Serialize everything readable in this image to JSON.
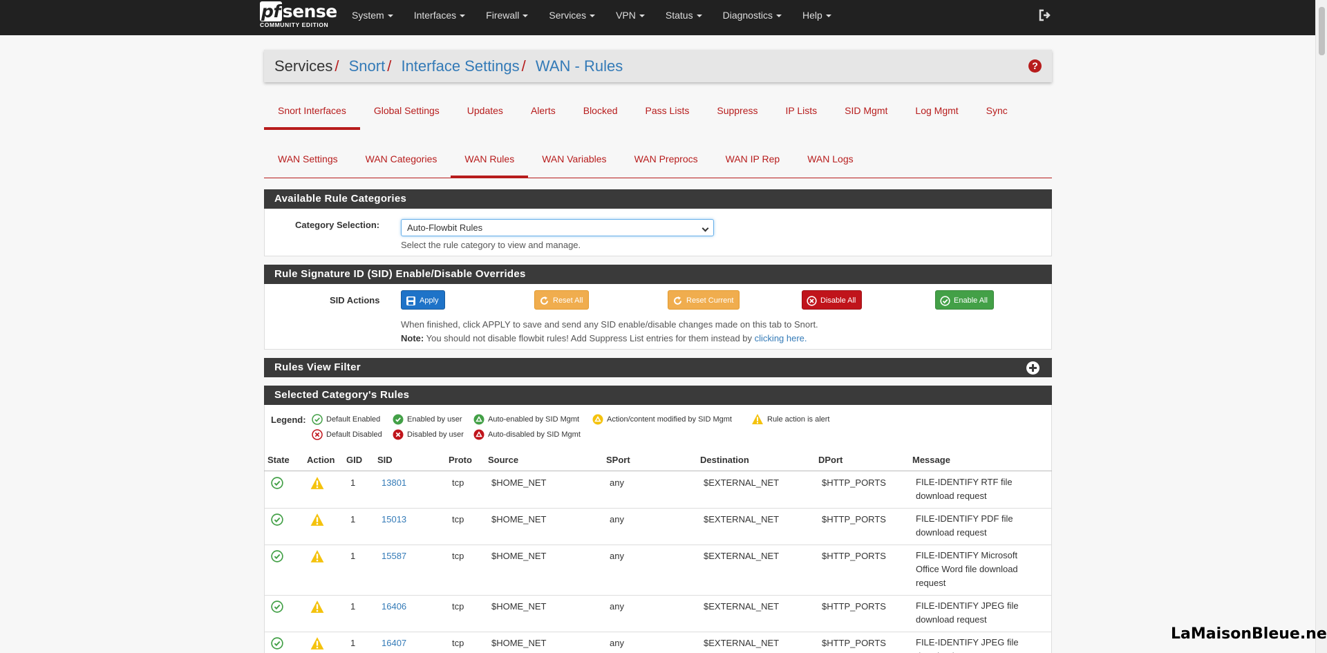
{
  "brand": {
    "logo_main_pf": "pf",
    "logo_main_rest": "sense",
    "logo_sub": "COMMUNITY EDITION"
  },
  "nav": [
    "System",
    "Interfaces",
    "Firewall",
    "Services",
    "VPN",
    "Status",
    "Diagnostics",
    "Help"
  ],
  "breadcrumb": {
    "root": "Services",
    "items": [
      "Snort",
      "Interface Settings",
      "WAN - Rules"
    ]
  },
  "tabs_primary": [
    "Snort Interfaces",
    "Global Settings",
    "Updates",
    "Alerts",
    "Blocked",
    "Pass Lists",
    "Suppress",
    "IP Lists",
    "SID Mgmt",
    "Log Mgmt",
    "Sync"
  ],
  "tabs_secondary": [
    "WAN Settings",
    "WAN Categories",
    "WAN Rules",
    "WAN Variables",
    "WAN Preprocs",
    "WAN IP Rep",
    "WAN Logs"
  ],
  "panel_categories": {
    "title": "Available Rule Categories",
    "label": "Category Selection:",
    "selected": "Auto-Flowbit Rules",
    "help": "Select the rule category to view and manage."
  },
  "panel_sid": {
    "title": "Rule Signature ID (SID) Enable/Disable Overrides",
    "label": "SID Actions",
    "buttons": {
      "apply": "Apply",
      "reset_all": "Reset All",
      "reset_current": "Reset Current",
      "disable_all": "Disable All",
      "enable_all": "Enable All"
    },
    "help_line1": "When finished, click APPLY to save and send any SID enable/disable changes made on this tab to Snort.",
    "note_label": "Note:",
    "note_text": "You should not disable flowbit rules! Add Suppress List entries for them instead by",
    "note_link": "clicking here."
  },
  "panel_filter": {
    "title": "Rules View Filter"
  },
  "panel_rules": {
    "title": "Selected Category's Rules",
    "legend_label": "Legend:",
    "legend": [
      "Default Enabled",
      "Enabled by user",
      "Auto-enabled by SID Mgmt",
      "Action/content modified by SID Mgmt",
      "Rule action is alert",
      "Default Disabled",
      "Disabled by user",
      "Auto-disabled by SID Mgmt"
    ],
    "columns": [
      "State",
      "Action",
      "GID",
      "SID",
      "Proto",
      "Source",
      "SPort",
      "Destination",
      "DPort",
      "Message"
    ],
    "rows": [
      {
        "gid": "1",
        "sid": "13801",
        "proto": "tcp",
        "source": "$HOME_NET",
        "sport": "any",
        "dest": "$EXTERNAL_NET",
        "dport": "$HTTP_PORTS",
        "msg": "FILE-IDENTIFY RTF file download request"
      },
      {
        "gid": "1",
        "sid": "15013",
        "proto": "tcp",
        "source": "$HOME_NET",
        "sport": "any",
        "dest": "$EXTERNAL_NET",
        "dport": "$HTTP_PORTS",
        "msg": "FILE-IDENTIFY PDF file download request"
      },
      {
        "gid": "1",
        "sid": "15587",
        "proto": "tcp",
        "source": "$HOME_NET",
        "sport": "any",
        "dest": "$EXTERNAL_NET",
        "dport": "$HTTP_PORTS",
        "msg": "FILE-IDENTIFY Microsoft Office Word file download request"
      },
      {
        "gid": "1",
        "sid": "16406",
        "proto": "tcp",
        "source": "$HOME_NET",
        "sport": "any",
        "dest": "$EXTERNAL_NET",
        "dport": "$HTTP_PORTS",
        "msg": "FILE-IDENTIFY JPEG file download request"
      },
      {
        "gid": "1",
        "sid": "16407",
        "proto": "tcp",
        "source": "$HOME_NET",
        "sport": "any",
        "dest": "$EXTERNAL_NET",
        "dport": "$HTTP_PORTS",
        "msg": "FILE-IDENTIFY JPEG file download request"
      }
    ]
  },
  "watermark": "LaMaisonBleue.net",
  "colors": {
    "accent": "#b71c1c",
    "link": "#337ab7",
    "navbar": "#212121",
    "panel_head": "#3a3a3a",
    "enabled_green": "#43a047",
    "alert_yellow": "#f4c20d"
  }
}
